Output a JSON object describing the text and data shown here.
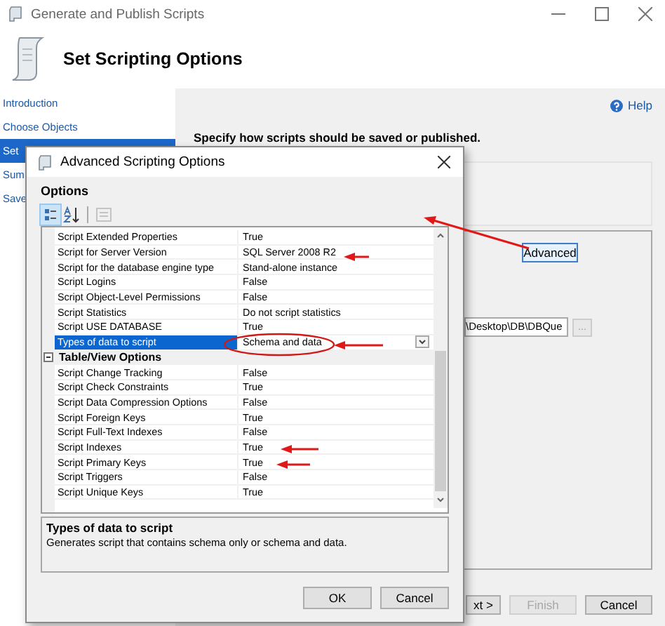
{
  "window": {
    "title": "Generate and Publish Scripts"
  },
  "header": {
    "title": "Set Scripting Options"
  },
  "nav": {
    "items": [
      {
        "label": "Introduction",
        "selected": false
      },
      {
        "label": "Choose Objects",
        "selected": false
      },
      {
        "label": "Set",
        "selected": true
      },
      {
        "label": "Sum",
        "selected": false
      },
      {
        "label": "Save",
        "selected": false
      }
    ]
  },
  "help": {
    "label": "Help"
  },
  "instruction": "Specify how scripts should be saved or published.",
  "advanced_button": {
    "label": "Advanced"
  },
  "path_field": {
    "value": "\\Desktop\\DB\\DBQue"
  },
  "browse_button": {
    "label": "..."
  },
  "footer_buttons": [
    {
      "label": "xt >",
      "disabled": false
    },
    {
      "label": "Finish",
      "disabled": true
    },
    {
      "label": "Cancel",
      "disabled": false
    }
  ],
  "dialog": {
    "title": "Advanced Scripting Options",
    "section": "Options",
    "toolbar": [
      {
        "kind": "categorized",
        "selected": true,
        "disabled": false
      },
      {
        "kind": "alphabetical",
        "selected": false,
        "disabled": false
      },
      {
        "kind": "property_pages",
        "selected": false,
        "disabled": true
      }
    ],
    "properties": [
      {
        "kind": "property",
        "name": "Script Extended Properties",
        "value": "True",
        "selected": false
      },
      {
        "kind": "property",
        "name": "Script for Server Version",
        "value": "SQL Server 2008 R2",
        "selected": false
      },
      {
        "kind": "property",
        "name": "Script for the database engine type",
        "value": "Stand-alone instance",
        "selected": false
      },
      {
        "kind": "property",
        "name": "Script Logins",
        "value": "False",
        "selected": false
      },
      {
        "kind": "property",
        "name": "Script Object-Level Permissions",
        "value": "False",
        "selected": false
      },
      {
        "kind": "property",
        "name": "Script Statistics",
        "value": "Do not script statistics",
        "selected": false
      },
      {
        "kind": "property",
        "name": "Script USE DATABASE",
        "value": "True",
        "selected": false
      },
      {
        "kind": "property",
        "name": "Types of data to script",
        "value": "Schema and data",
        "selected": true
      },
      {
        "kind": "category",
        "name": "Table/View Options",
        "expanded": true
      },
      {
        "kind": "property",
        "name": "Script Change Tracking",
        "value": "False",
        "selected": false
      },
      {
        "kind": "property",
        "name": "Script Check Constraints",
        "value": "True",
        "selected": false
      },
      {
        "kind": "property",
        "name": "Script Data Compression Options",
        "value": "False",
        "selected": false
      },
      {
        "kind": "property",
        "name": "Script Foreign Keys",
        "value": "True",
        "selected": false
      },
      {
        "kind": "property",
        "name": "Script Full-Text Indexes",
        "value": "False",
        "selected": false
      },
      {
        "kind": "property",
        "name": "Script Indexes",
        "value": "True",
        "selected": false
      },
      {
        "kind": "property",
        "name": "Script Primary Keys",
        "value": "True",
        "selected": false
      },
      {
        "kind": "property",
        "name": "Script Triggers",
        "value": "False",
        "selected": false
      },
      {
        "kind": "property",
        "name": "Script Unique Keys",
        "value": "True",
        "selected": false
      }
    ],
    "description": {
      "title": "Types of data to script",
      "text": "Generates script that contains schema only or schema and data."
    },
    "buttons": [
      "OK",
      "Cancel"
    ]
  }
}
